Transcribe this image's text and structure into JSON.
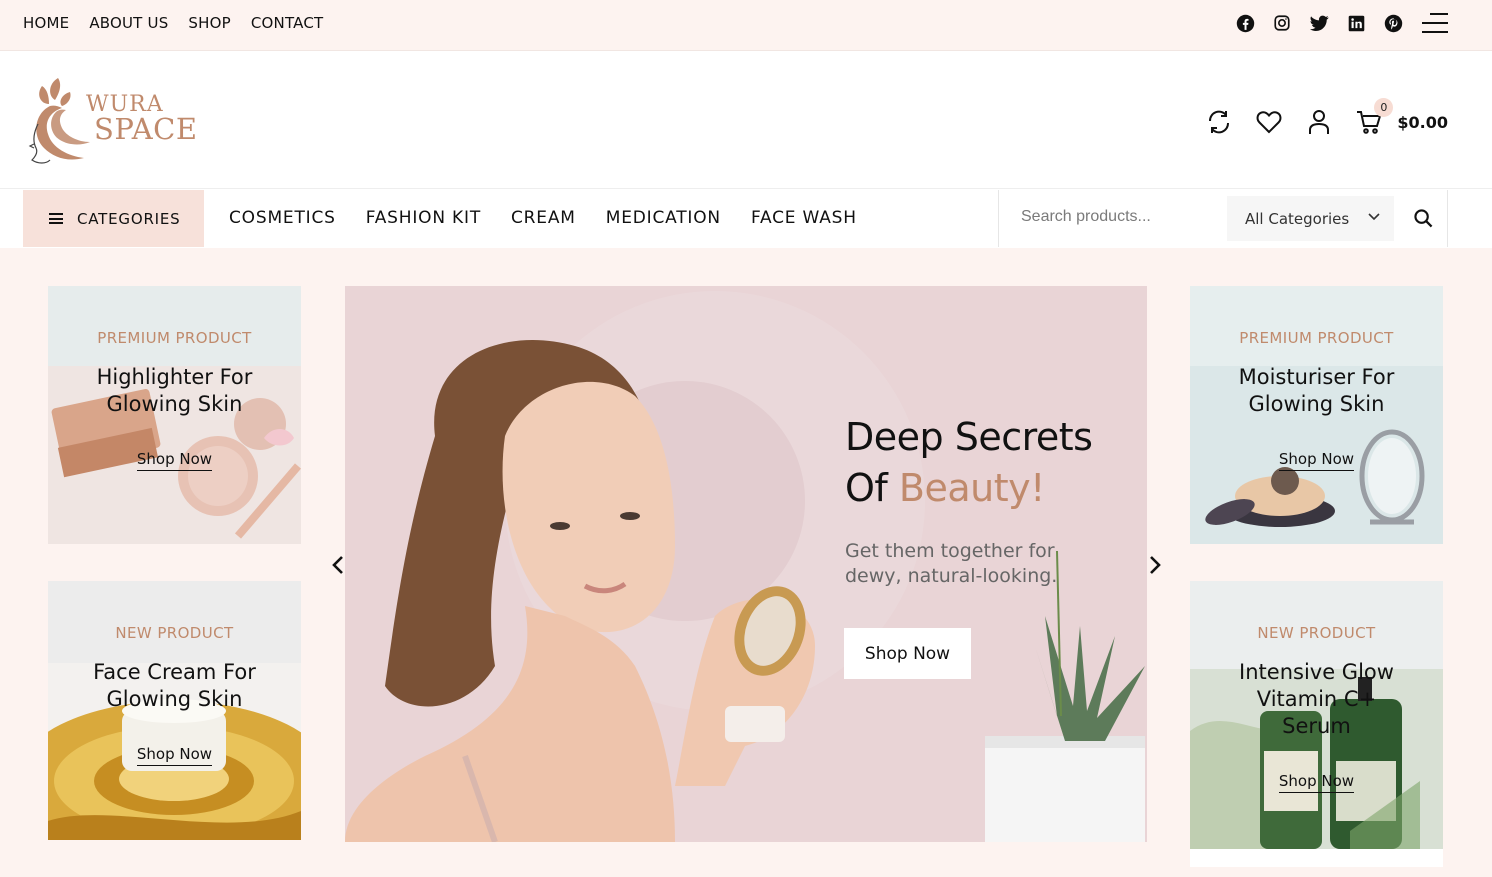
{
  "topbar": {
    "nav": [
      "HOME",
      "ABOUT US",
      "SHOP",
      "CONTACT"
    ],
    "social_icons": [
      "facebook-icon",
      "instagram-icon",
      "twitter-icon",
      "linkedin-icon",
      "pinterest-icon"
    ]
  },
  "header": {
    "logo_line1": "WURA",
    "logo_line2": "SPACE",
    "cart_count": "0",
    "cart_total": "$0.00"
  },
  "nav": {
    "categories_label": "CATEGORIES",
    "items": [
      "COSMETICS",
      "FASHION KIT",
      "CREAM",
      "MEDICATION",
      "FACE WASH"
    ],
    "search_placeholder": "Search products...",
    "category_select": "All Categories"
  },
  "cards": {
    "left_top": {
      "tag": "PREMIUM PRODUCT",
      "title_1": "Highlighter For",
      "title_2": "Glowing Skin",
      "shop": "Shop Now"
    },
    "left_bottom": {
      "tag": "NEW PRODUCT",
      "title_1": "Face Cream For",
      "title_2": "Glowing Skin",
      "shop": "Shop Now"
    },
    "right_top": {
      "tag": "PREMIUM PRODUCT",
      "title_1": "Moisturiser For",
      "title_2": "Glowing Skin",
      "shop": "Shop Now"
    },
    "right_bottom": {
      "tag": "NEW PRODUCT",
      "title_1": "Intensive Glow",
      "title_2": "Vitamin C+",
      "title_3": "Serum",
      "shop": "Shop Now"
    }
  },
  "hero": {
    "headline_1": "Deep Secrets",
    "headline_2a": "Of ",
    "headline_2b": "Beauty!",
    "subtext": "Get them together for dewy, natural-looking.",
    "cta": "Shop Now"
  },
  "colors": {
    "accent": "#c08a6c",
    "topbar_bg": "#fdf3f0",
    "category_btn_bg": "#f7e1da"
  }
}
